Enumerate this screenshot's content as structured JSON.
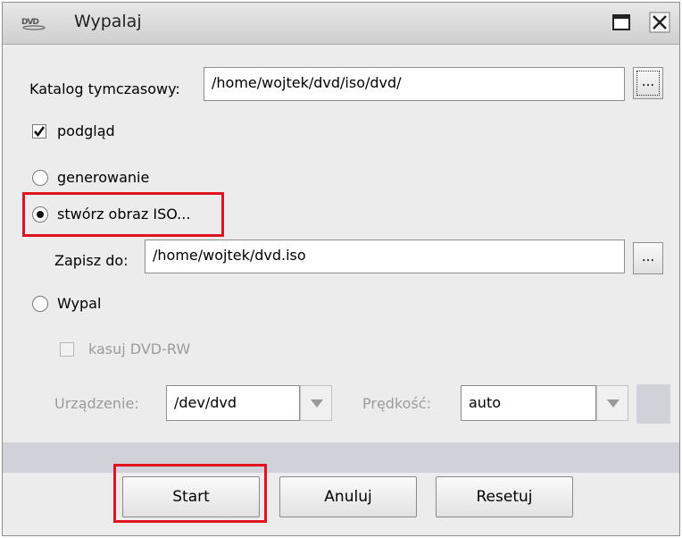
{
  "window": {
    "title": "Wypalaj",
    "icon_name": "dvd-icon",
    "icon_text": "DVD"
  },
  "temp_dir": {
    "label": "Katalog tymczasowy:",
    "value": "/home/wojtek/dvd/iso/dvd/",
    "browse_label": "..."
  },
  "preview": {
    "label": "podgląd",
    "checked": true
  },
  "modes": {
    "generate": {
      "label": "generowanie",
      "selected": false
    },
    "iso": {
      "label": "stwórz obraz ISO...",
      "selected": true
    },
    "burn": {
      "label": "Wypal",
      "selected": false
    }
  },
  "save_to": {
    "label": "Zapisz do:",
    "value": "/home/wojtek/dvd.iso",
    "browse_label": "..."
  },
  "erase_rw": {
    "label": "kasuj DVD-RW",
    "checked": false,
    "enabled": false
  },
  "device": {
    "label": "Urządzenie:",
    "value": "/dev/dvd"
  },
  "speed": {
    "label": "Prędkość:",
    "value": "auto"
  },
  "buttons": {
    "start": "Start",
    "cancel": "Anuluj",
    "reset": "Resetuj"
  },
  "colors": {
    "highlight": "#e0141e",
    "window_bg": "#ececec",
    "band": "#d1d1da"
  }
}
